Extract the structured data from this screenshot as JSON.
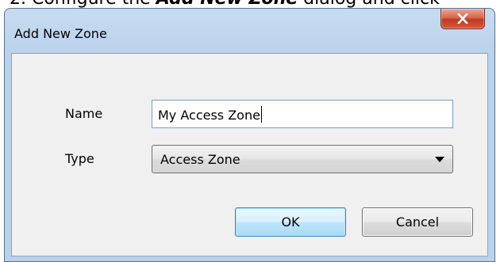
{
  "doc_snippet": {
    "prefix": "2. Configure the ",
    "bold": "Add New Zone",
    "suffix": " dialog and click"
  },
  "dialog": {
    "title": "Add New Zone",
    "close_icon": "close-x-icon",
    "fields": {
      "name_label": "Name",
      "name_value": "My Access Zone",
      "type_label": "Type",
      "type_value": "Access Zone"
    },
    "buttons": {
      "ok_label": "OK",
      "cancel_label": "Cancel"
    }
  },
  "colors": {
    "title_bar": "#b9d1ea",
    "close_button": "#c2391f",
    "client_area": "#f0f0f0",
    "ok_button_accent": "#3c7fb1"
  }
}
